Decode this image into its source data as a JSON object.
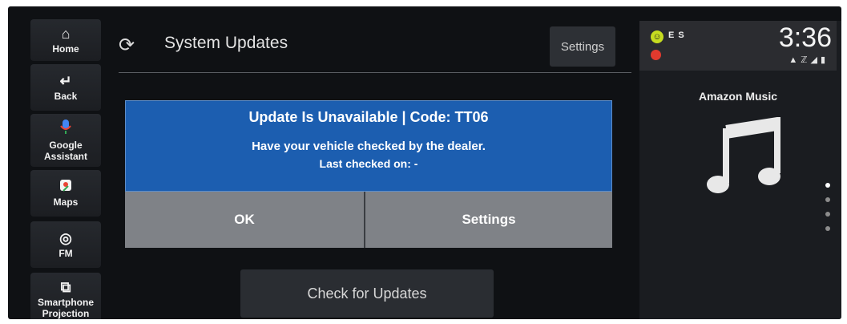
{
  "nav": {
    "items": [
      {
        "id": "home",
        "icon": "home-icon",
        "glyph": "⌂",
        "label": "Home"
      },
      {
        "id": "back",
        "icon": "back-icon",
        "glyph": "↵",
        "label": "Back"
      },
      {
        "id": "google",
        "icon": "microphone-icon",
        "glyph": "🎙",
        "label": "Google Assistant"
      },
      {
        "id": "maps",
        "icon": "maps-icon",
        "glyph": "◉",
        "label": "Maps"
      },
      {
        "id": "fm",
        "icon": "radio-icon",
        "glyph": "◎",
        "label": "FM"
      },
      {
        "id": "projection",
        "icon": "phone-projection-icon",
        "glyph": "⧉",
        "label": "Smartphone Projection"
      }
    ]
  },
  "header": {
    "title": "System Updates",
    "settings_label": "Settings"
  },
  "dialog": {
    "title": "Update Is Unavailable | Code: TT06",
    "message": "Have your vehicle checked by the dealer.",
    "last_checked": "Last checked on: -",
    "ok_label": "OK",
    "settings_label": "Settings",
    "color": "#1c5eb0"
  },
  "main": {
    "check_label": "Check for Updates"
  },
  "status": {
    "user": "E S",
    "time": "3:36",
    "icons": [
      "signal-icon",
      "bluetooth-icon",
      "network-icon",
      "battery-icon"
    ]
  },
  "media": {
    "app": "Amazon Music",
    "icon": "music-note-icon",
    "pages": 4,
    "active_page": 1
  }
}
